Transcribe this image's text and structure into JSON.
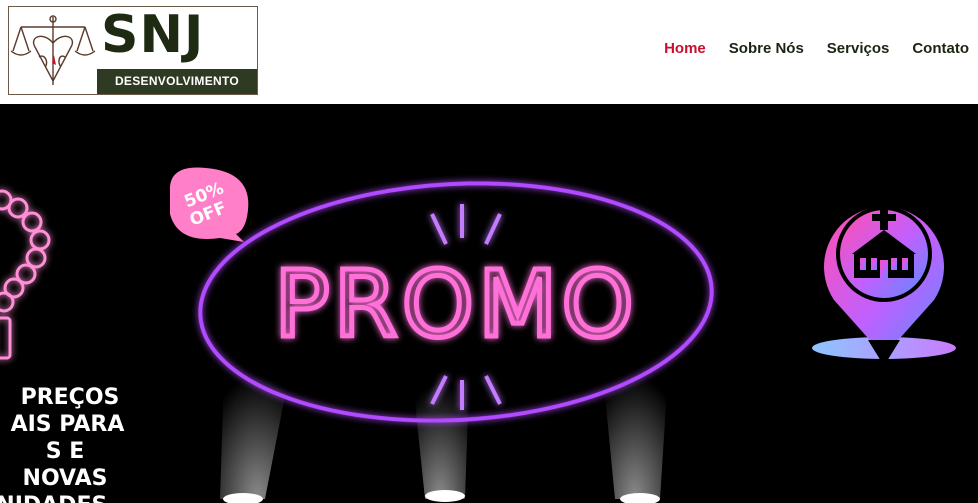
{
  "logo": {
    "brand": "SNJ",
    "tagline": "DESENVOLVIMENTO"
  },
  "nav": {
    "items": [
      {
        "label": "Home",
        "active": true
      },
      {
        "label": "Sobre Nós",
        "active": false
      },
      {
        "label": "Serviços",
        "active": false
      },
      {
        "label": "Contato",
        "active": false
      }
    ]
  },
  "hero": {
    "badge_percent": "50%",
    "badge_off": "OFF",
    "neon_word": "PROMO",
    "side_text": [
      "PREÇOS",
      "AIS PARA",
      "S E NOVAS",
      "NIDADES."
    ],
    "colors": {
      "neon": "#ff6fd8",
      "ring": "#b24cff",
      "badge": "#ff7fc8"
    }
  }
}
